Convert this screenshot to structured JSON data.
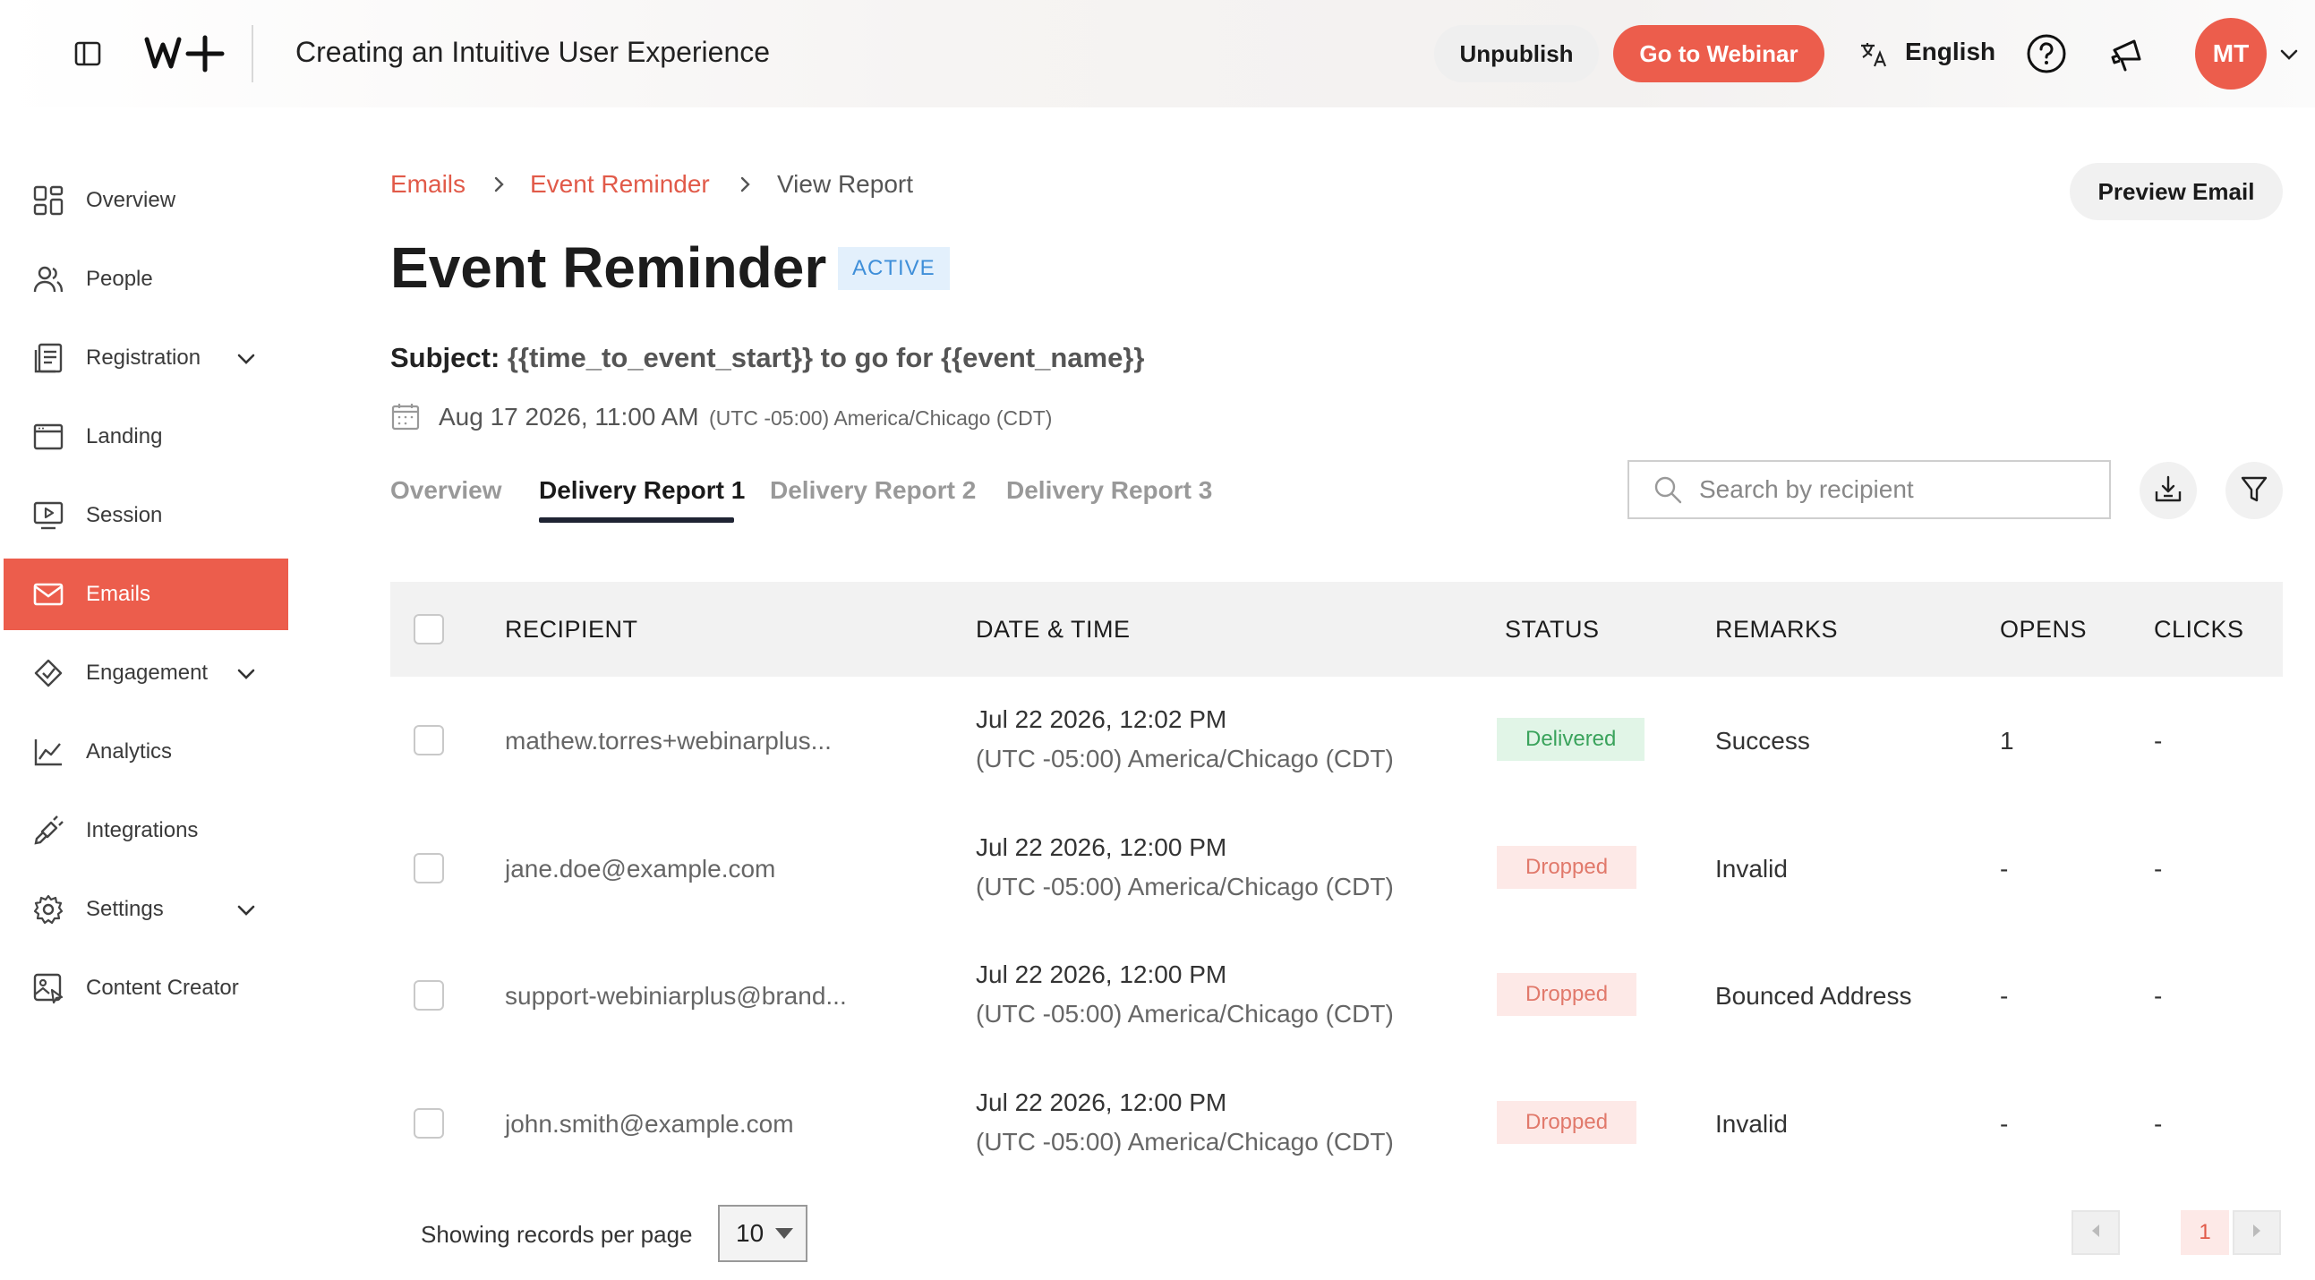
{
  "header": {
    "app_title": "Creating an Intuitive User Experience",
    "unpublish_label": "Unpublish",
    "go_to_webinar_label": "Go to Webinar",
    "language": "English",
    "avatar_initials": "MT",
    "accent_color": "#ec5d4c"
  },
  "sidebar": {
    "items": [
      {
        "label": "Overview",
        "icon": "grid-icon"
      },
      {
        "label": "People",
        "icon": "people-icon"
      },
      {
        "label": "Registration",
        "icon": "registration-icon"
      },
      {
        "label": "Landing",
        "icon": "landing-icon"
      },
      {
        "label": "Session",
        "icon": "session-icon"
      },
      {
        "label": "Emails",
        "icon": "mail-icon"
      },
      {
        "label": "Engagement",
        "icon": "engagement-icon"
      },
      {
        "label": "Analytics",
        "icon": "analytics-icon"
      },
      {
        "label": "Integrations",
        "icon": "plug-icon"
      },
      {
        "label": "Settings",
        "icon": "gear-icon"
      },
      {
        "label": "Content Creator",
        "icon": "content-creator-icon"
      }
    ],
    "active": "Emails"
  },
  "breadcrumb": {
    "items": [
      "Emails",
      "Event Reminder",
      "View Report"
    ]
  },
  "page": {
    "preview_email_label": "Preview Email",
    "title": "Event Reminder",
    "status": "ACTIVE",
    "subject_label": "Subject:",
    "subject_value": "{{time_to_event_start}} to go for {{event_name}}",
    "date": "Aug 17 2026, 11:00 AM",
    "timezone": "(UTC -05:00) America/Chicago (CDT)"
  },
  "tabs": [
    "Overview",
    "Delivery Report 1",
    "Delivery Report 2",
    "Delivery Report 3"
  ],
  "active_tab": "Delivery Report 1",
  "search": {
    "placeholder": "Search by recipient"
  },
  "table": {
    "columns": [
      "RECIPIENT",
      "DATE & TIME",
      "STATUS",
      "REMARKS",
      "OPENS",
      "CLICKS"
    ],
    "rows": [
      {
        "recipient": "mathew.torres+webinarplus...",
        "date": "Jul 22 2026, 12:02 PM",
        "tz": "(UTC -05:00) America/Chicago (CDT)",
        "status": "Delivered",
        "remarks": "Success",
        "opens": "1",
        "clicks": "-"
      },
      {
        "recipient": "jane.doe@example.com",
        "date": "Jul 22 2026, 12:00 PM",
        "tz": "(UTC -05:00) America/Chicago (CDT)",
        "status": "Dropped",
        "remarks": "Invalid",
        "opens": "-",
        "clicks": "-"
      },
      {
        "recipient": "support-webiniarplus@brand...",
        "date": "Jul 22 2026, 12:00 PM",
        "tz": "(UTC -05:00) America/Chicago (CDT)",
        "status": "Dropped",
        "remarks": "Bounced Address",
        "opens": "-",
        "clicks": "-"
      },
      {
        "recipient": "john.smith@example.com",
        "date": "Jul 22 2026, 12:00 PM",
        "tz": "(UTC -05:00) America/Chicago (CDT)",
        "status": "Dropped",
        "remarks": "Invalid",
        "opens": "-",
        "clicks": "-"
      }
    ]
  },
  "footer": {
    "records_label": "Showing records per page",
    "per_page": "10",
    "current_page": "1"
  }
}
